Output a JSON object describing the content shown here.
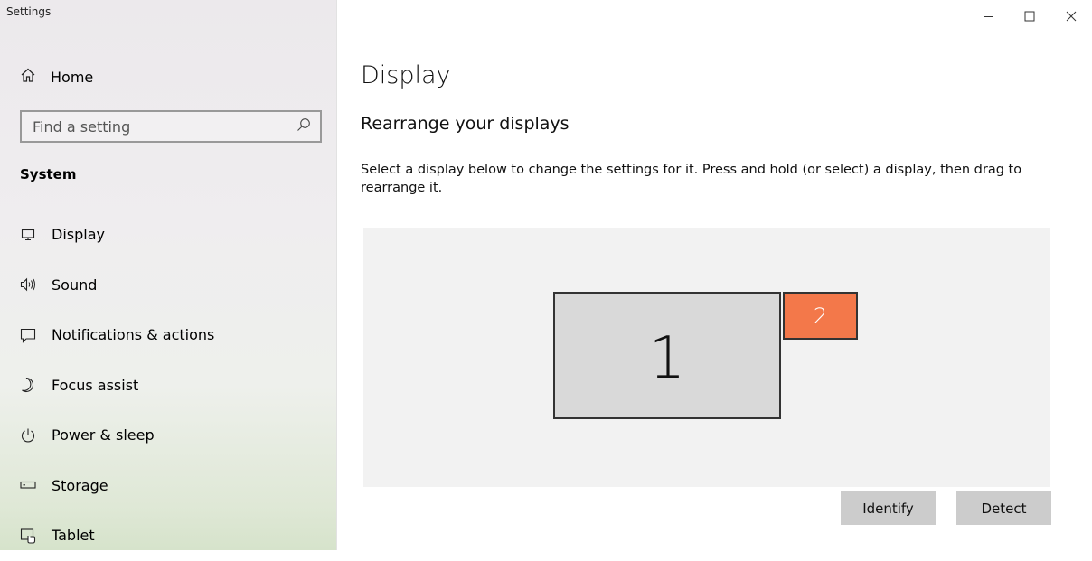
{
  "window": {
    "title": "Settings"
  },
  "sidebar": {
    "home": {
      "label": "Home",
      "icon": "home-icon"
    },
    "search": {
      "placeholder": "Find a setting",
      "icon": "search-icon"
    },
    "section": "System",
    "items": [
      {
        "label": "Display",
        "icon": "monitor-icon",
        "active": true
      },
      {
        "label": "Sound",
        "icon": "speaker-icon"
      },
      {
        "label": "Notifications & actions",
        "icon": "notification-icon"
      },
      {
        "label": "Focus assist",
        "icon": "moon-icon"
      },
      {
        "label": "Power & sleep",
        "icon": "power-icon"
      },
      {
        "label": "Storage",
        "icon": "storage-icon"
      },
      {
        "label": "Tablet",
        "icon": "tablet-icon"
      }
    ]
  },
  "main": {
    "title": "Display",
    "subheading": "Rearrange your displays",
    "description": "Select a display below to change the settings for it. Press and hold (or select) a display, then drag to rearrange it.",
    "displays": [
      {
        "number": "1",
        "selected": false,
        "color": "#d9d9d9"
      },
      {
        "number": "2",
        "selected": true,
        "color": "#f3784a"
      }
    ],
    "buttons": {
      "identify": "Identify",
      "detect": "Detect"
    }
  },
  "colors": {
    "accent": "#f3784a",
    "panel": "#f2f2f2",
    "button": "#cccccc"
  }
}
